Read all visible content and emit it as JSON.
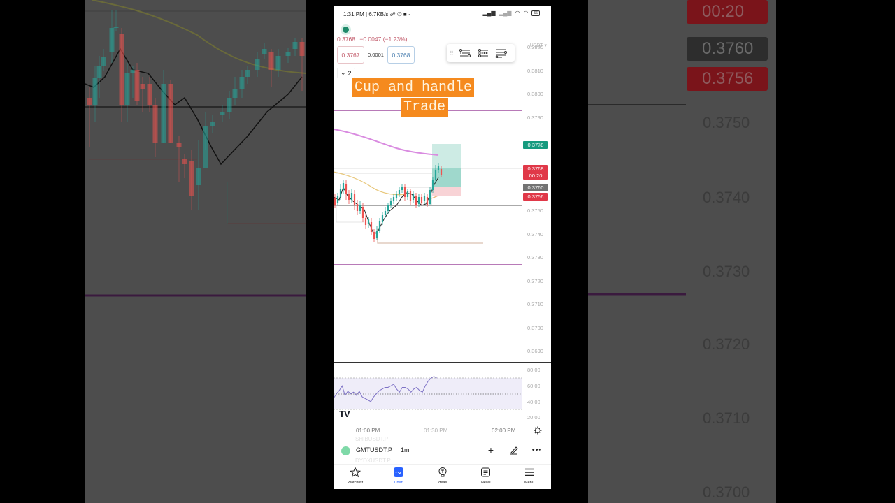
{
  "status_bar": {
    "time_speed": "1:31 PM | 6.7KB/s",
    "battery": "66"
  },
  "header": {
    "currency_selector": "USDT ▾",
    "last_price": "0.3768",
    "change": "−0.0047",
    "change_pct": "(−1.23%)",
    "bid": "0.3767",
    "spread": "0.0001",
    "ask": "0.3768",
    "indicator_count": "2"
  },
  "annotation": {
    "line1": "Cup and handle",
    "line2": "Trade"
  },
  "price_axis": {
    "labels": [
      "0.3820",
      "0.3810",
      "0.3800",
      "0.3790",
      "0.3750",
      "0.3740",
      "0.3730",
      "0.3720",
      "0.3710",
      "0.3700",
      "0.3690"
    ],
    "tags": {
      "target": "0.3778",
      "current": "0.3768",
      "countdown": "00:20",
      "entry": "0.3760",
      "stop": "0.3756"
    }
  },
  "rsi_axis": {
    "labels": [
      "80.00",
      "60.00",
      "40.00",
      "20.00"
    ]
  },
  "time_axis": {
    "labels": [
      "01:00 PM",
      "01:30 PM",
      "02:00 PM"
    ]
  },
  "symbol_bar": {
    "symbol": "GMTUSDT.P",
    "interval": "1m",
    "ghost_above": "SHIBUSDT.P",
    "ghost_below": "DYDXUSDT.P"
  },
  "bottom_nav": {
    "items": [
      {
        "label": "Watchlist",
        "icon": "star-icon"
      },
      {
        "label": "Chart",
        "icon": "chart-icon"
      },
      {
        "label": "Ideas",
        "icon": "lightbulb-icon"
      },
      {
        "label": "News",
        "icon": "news-icon"
      },
      {
        "label": "Menu",
        "icon": "menu-icon"
      }
    ]
  },
  "background_zoom": {
    "axis_labels": [
      "0.3750",
      "0.3740",
      "0.3730",
      "0.3720",
      "0.3710",
      "0.3700"
    ],
    "tags": {
      "countdown": "00:20",
      "entry": "0.3760",
      "stop": "0.3756"
    }
  },
  "colors": {
    "up": "#26a69a",
    "down": "#ef5350",
    "annotation_bg": "#f58a1e",
    "horizontal_level": "#8e2a8e",
    "ma_slow": "#d98be0",
    "ma_mid": "#e8c77a"
  }
}
